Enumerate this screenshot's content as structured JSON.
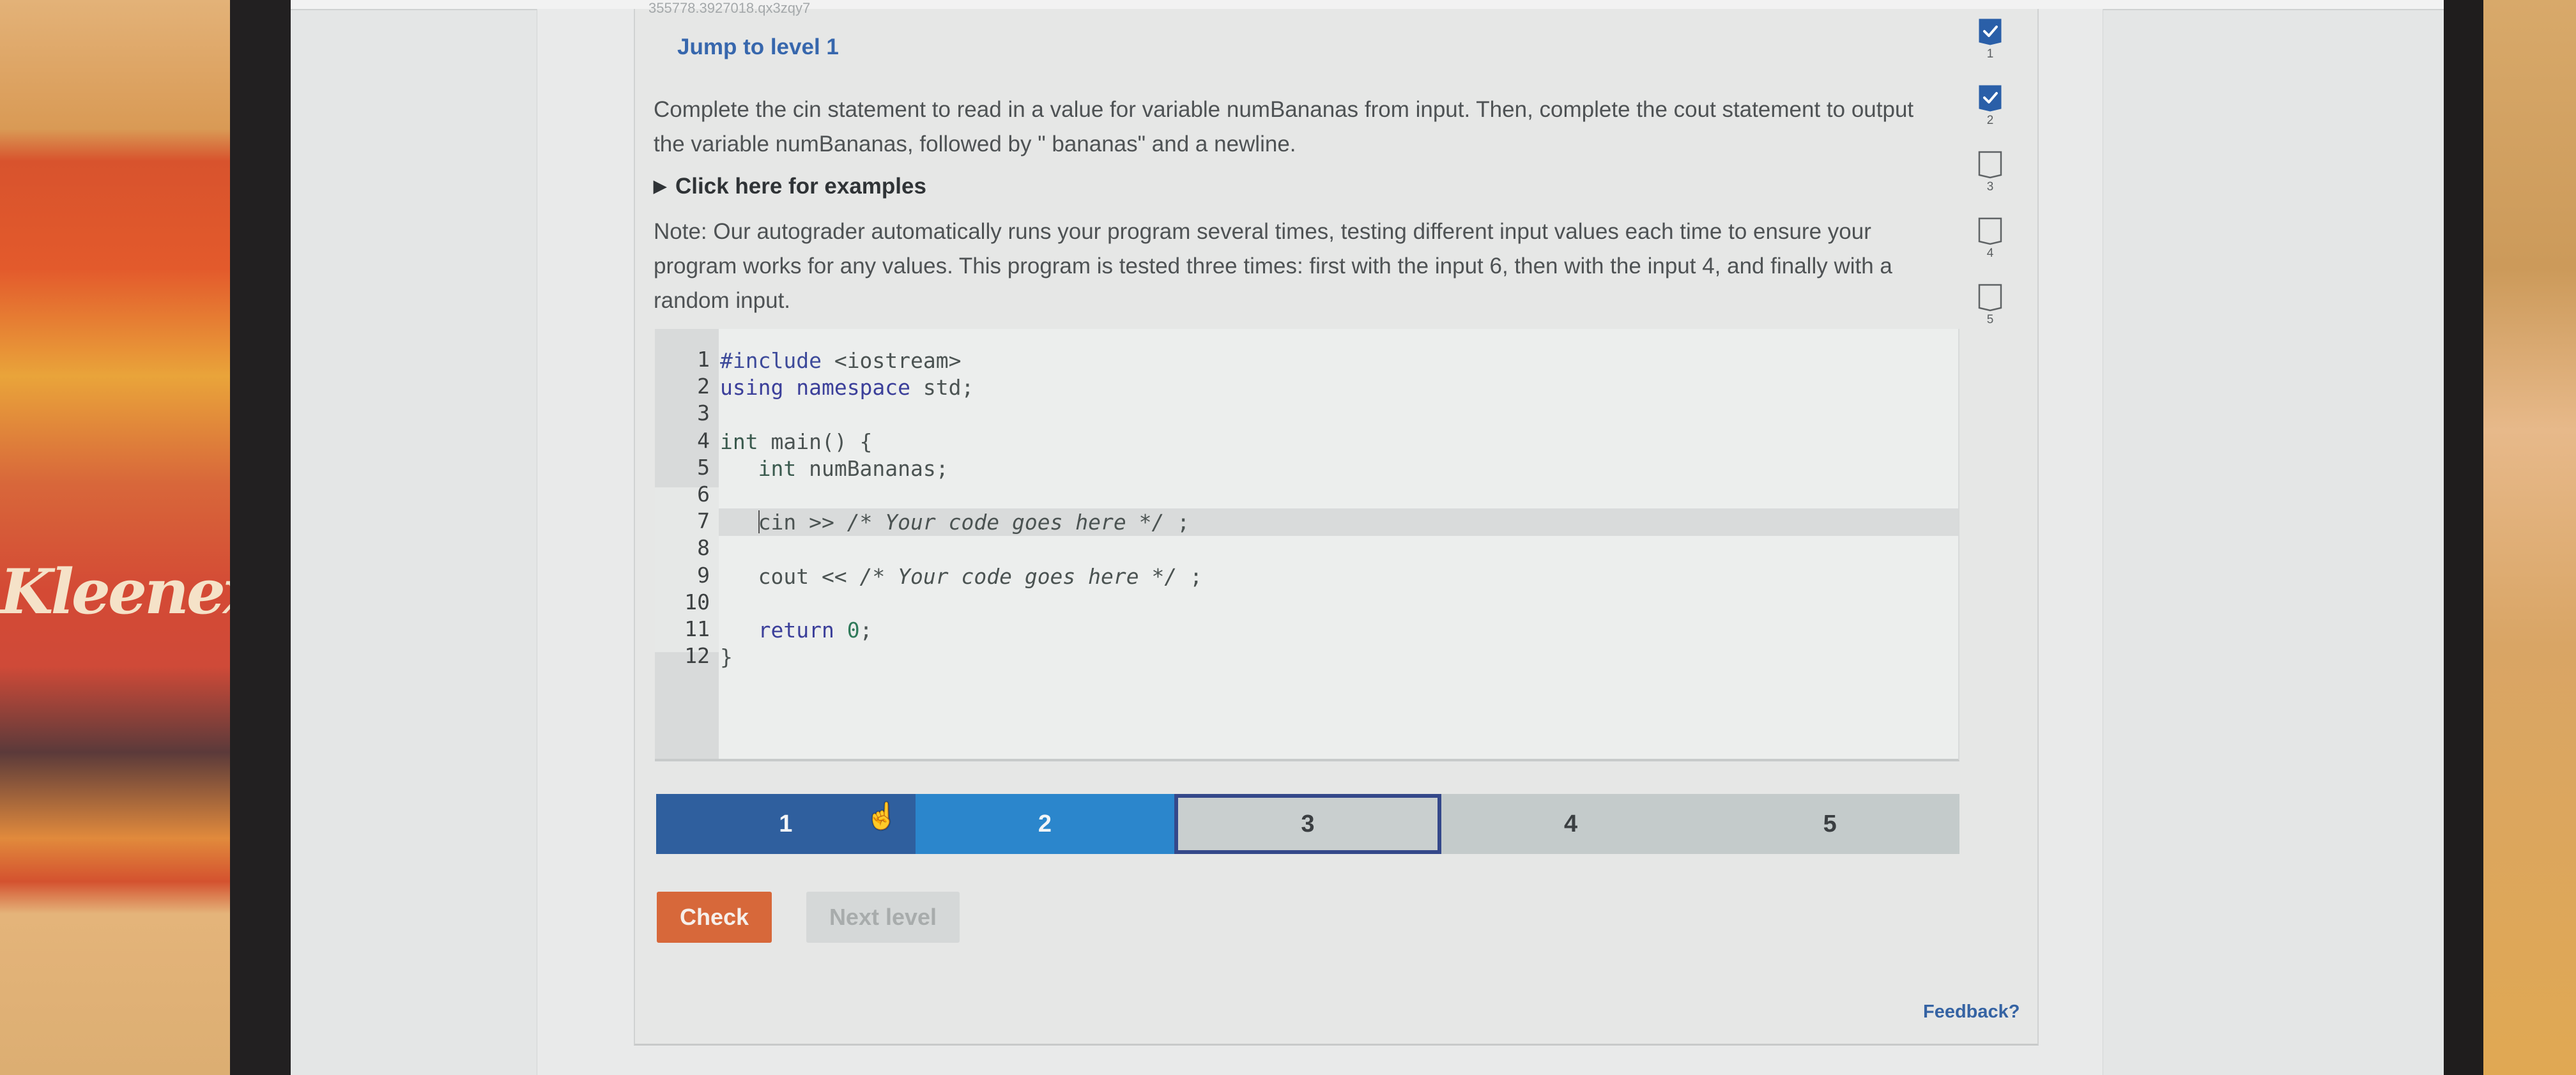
{
  "header": {
    "activity_id": "355778.3927018.qx3zqy7",
    "jump_link": "Jump to level 1"
  },
  "instructions": {
    "main": "Complete the cin statement to read in a value for variable numBananas from input. Then, complete the cout statement to output the variable numBananas, followed by \" bananas\" and a newline.",
    "examples_toggle": "Click here for examples",
    "note": "Note: Our autograder automatically runs your program several times, testing different input values each time to ensure your program works for any values. This program is tested three times: first with the input 6, then with the input 4, and finally with a random input."
  },
  "editor": {
    "lines": [
      {
        "n": "1",
        "code": "#include <iostream>"
      },
      {
        "n": "2",
        "code": "using namespace std;"
      },
      {
        "n": "3",
        "code": ""
      },
      {
        "n": "4",
        "code": "int main() {"
      },
      {
        "n": "5",
        "code": "   int numBananas;"
      },
      {
        "n": "6",
        "code": ""
      },
      {
        "n": "7",
        "code": "   cin >> /* Your code goes here */ ;"
      },
      {
        "n": "8",
        "code": ""
      },
      {
        "n": "9",
        "code": "   cout << /* Your code goes here */ ;"
      },
      {
        "n": "10",
        "code": ""
      },
      {
        "n": "11",
        "code": "   return 0;"
      },
      {
        "n": "12",
        "code": "}"
      }
    ],
    "active_line": 7
  },
  "levels": {
    "items": [
      {
        "label": "1",
        "state": "completed"
      },
      {
        "label": "2",
        "state": "completed"
      },
      {
        "label": "3",
        "state": "current"
      },
      {
        "label": "4",
        "state": "locked"
      },
      {
        "label": "5",
        "state": "locked"
      }
    ],
    "completed_count": 2,
    "total": 5
  },
  "actions": {
    "check_label": "Check",
    "next_label": "Next level",
    "feedback_link": "Feedback?"
  },
  "progress_sidebar": {
    "items": [
      {
        "label": "1",
        "checked": true
      },
      {
        "label": "2",
        "checked": true
      },
      {
        "label": "3",
        "checked": false
      },
      {
        "label": "4",
        "checked": false
      },
      {
        "label": "5",
        "checked": false
      }
    ]
  },
  "colors": {
    "accent_blue": "#3767ad",
    "level_done": "#2f5f9e",
    "level_done_light": "#2b86cc",
    "level_current_border": "#34488a",
    "check_button": "#d7683a"
  },
  "background": {
    "tissue_brand": "Kleenex"
  }
}
